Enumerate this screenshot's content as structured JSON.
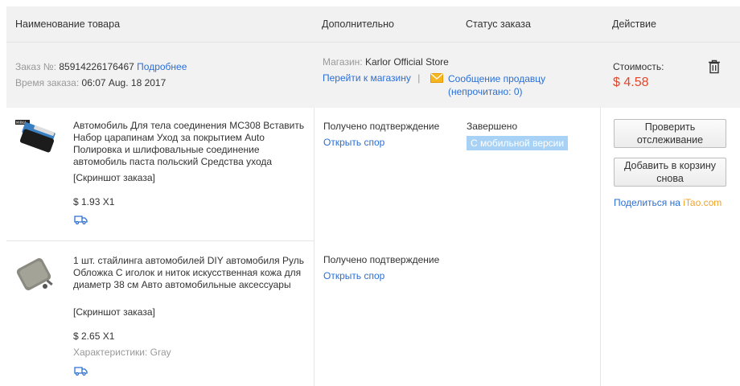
{
  "header": {
    "product_name": "Наименование товара",
    "additional": "Дополнительно",
    "order_status": "Статус заказа",
    "action": "Действие"
  },
  "order": {
    "order_no_label": "Заказ №:",
    "order_no": "85914226176467",
    "details_link": "Подробнее",
    "order_time_label": "Время заказа:",
    "order_time": "06:07 Aug. 18 2017",
    "store_label": "Магазин:",
    "store_name": "Karlor Official Store",
    "go_to_store": "Перейти к магазину",
    "separator": "|",
    "message_seller": "Сообщение продавцу",
    "unread": "(непрочитано: 0)",
    "cost_label": "Стоимость:",
    "cost": "$ 4.58"
  },
  "items": [
    {
      "title": "Автомобиль Для тела соединения MC308 Вставить Набор царапинам Уход за покрытием Auto Полировка и шлифовальные соединение автомобиль паста польский Средства ухода",
      "snapshot": "[Скриншот заказа]",
      "price": "$ 1.93 X1",
      "status_text": "Получено подтверждение",
      "dispute_link": "Открыть спор"
    },
    {
      "title": "1 шт. стайлинга автомобилей DIY автомобиля Руль Обложка С иголок и ниток искусственная кожа для диаметр 38 см Авто автомобильные аксессуары",
      "snapshot": "[Скриншот заказа]",
      "price": "$ 2.65 X1",
      "characteristics": "Характеристики: Gray",
      "status_text": "Получено подтверждение",
      "dispute_link": "Открыть спор"
    }
  ],
  "status": {
    "completed": "Завершено",
    "mobile_badge": "С мобильной версии"
  },
  "actions": {
    "check_tracking": "Проверить отслеживание",
    "add_to_cart_again": "Добавить в корзину снова",
    "share_prefix": "Поделиться на ",
    "share_site": "iTao.com"
  },
  "colors": {
    "link": "#2a6fd6",
    "price": "#e2462b",
    "badge": "#a8d2f5",
    "header_bg": "#f1f1f1"
  }
}
